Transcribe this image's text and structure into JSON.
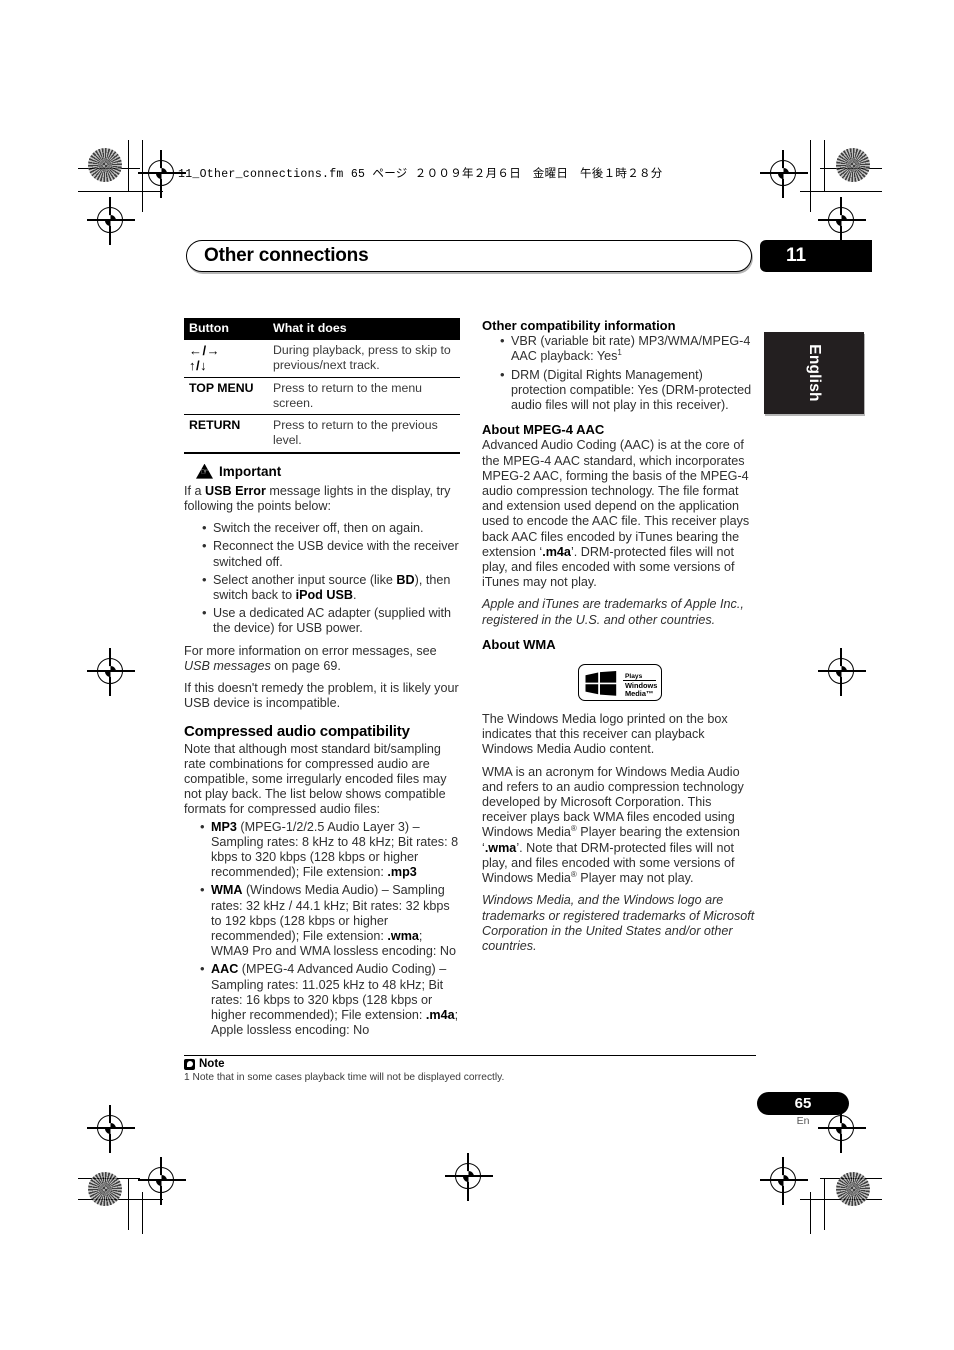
{
  "print_marks": {
    "file_stamp": "11_Other_connections.fm  65 ページ  ２００９年２月６日　金曜日　午後１時２８分"
  },
  "header": {
    "chapter_title": "Other connections",
    "chapter_number": "11",
    "language_tab": "English"
  },
  "left_column": {
    "table": {
      "headers": [
        "Button",
        "What it does"
      ],
      "rows": [
        {
          "button_lines": [
            "←/→",
            "↑/↓"
          ],
          "description": "During playback, press to skip to previous/next track."
        },
        {
          "button": "TOP MENU",
          "description": "Press to return to the menu screen."
        },
        {
          "button": "RETURN",
          "description": "Press to return to the previous level."
        }
      ]
    },
    "important": {
      "label": "Important",
      "icon": "warning-triangle-hand-icon",
      "intro_prefix": "If a ",
      "intro_bold": "USB Error",
      "intro_suffix": " message lights in the display, try following the points below:",
      "bullets": [
        "Switch the receiver off, then on again.",
        "Reconnect the USB device with the receiver switched off.",
        "Select another input source (like BD), then switch back to iPod USB.",
        "Use a dedicated AC adapter (supplied with the device) for USB power."
      ],
      "bullet3_parts": {
        "p1": "Select another input source (like ",
        "b1": "BD",
        "p2": "), then switch back to ",
        "b2": "iPod USB",
        "p3": "."
      },
      "after_1_prefix": "For more information on error messages, see ",
      "after_1_italic": "USB messages",
      "after_1_suffix": " on page 69.",
      "after_2": "If this doesn't remedy the problem, it is likely your USB device is incompatible."
    },
    "compressed": {
      "heading": "Compressed audio compatibility",
      "intro": "Note that although most standard bit/sampling rate combinations for compressed audio are compatible, some irregularly encoded files may not play back. The list below shows compatible formats for compressed audio files:",
      "formats": [
        {
          "name": "MP3",
          "detail_before_ext": " (MPEG-1/2/2.5 Audio Layer 3) – Sampling rates: 8 kHz to 48 kHz; Bit rates: 8 kbps to 320 kbps (128 kbps or higher recommended); File extension: ",
          "extension": ".mp3",
          "detail_after_ext": ""
        },
        {
          "name": "WMA",
          "detail_before_ext": " (Windows Media Audio) – Sampling rates: 32 kHz / 44.1 kHz; Bit rates: 32 kbps to 192 kbps (128 kbps or higher recommended); File extension: ",
          "extension": ".wma",
          "detail_after_ext": "; WMA9 Pro and WMA lossless encoding: No"
        },
        {
          "name": "AAC",
          "detail_before_ext": " (MPEG-4 Advanced Audio Coding) – Sampling rates: 11.025 kHz to 48 kHz; Bit rates: 16 kbps to 320 kbps (128 kbps or higher recommended); File extension: ",
          "extension": ".m4a",
          "detail_after_ext": "; Apple lossless encoding: No"
        }
      ]
    }
  },
  "right_column": {
    "other_compat": {
      "heading": "Other compatibility information",
      "bullet1_text": "VBR (variable bit rate) MP3/WMA/MPEG-4 AAC playback: Yes",
      "bullet1_sup": "1",
      "bullet2": "DRM (Digital Rights Management) protection compatible: Yes (DRM-protected audio files will not play in this receiver)."
    },
    "about_aac": {
      "heading": "About MPEG-4 AAC",
      "body_p1": "Advanced Audio Coding (AAC) is at the core of the MPEG-4 AAC standard, which incorporates MPEG-2 AAC, forming the basis of the MPEG-4 audio compression technology. The file format and extension used depend on the application used to encode the AAC file. This receiver plays back AAC files encoded by iTunes bearing the extension ‘",
      "body_ext": ".m4a",
      "body_p2": "’. DRM-protected files will not play, and files encoded with some versions of iTunes may not play.",
      "trademark": "Apple and iTunes are trademarks of Apple Inc., registered in the U.S. and other countries."
    },
    "about_wma": {
      "heading": "About WMA",
      "logo": {
        "icon": "windows-flag-icon",
        "plays": "Plays",
        "line1": "Windows",
        "line2": "Media™",
        "tm_mark": "™"
      },
      "body_p1": "The Windows Media logo printed on the box indicates that this receiver can playback Windows Media Audio content.",
      "body_p2_a": "WMA is an acronym for Windows Media Audio and refers to an audio compression technology developed by Microsoft Corporation. This receiver plays back WMA files encoded using Windows Media",
      "body_p2_sup1": "®",
      "body_p2_b": " Player bearing the extension ‘",
      "body_p2_ext": ".wma",
      "body_p2_c": "’. Note that DRM-protected files will not play, and files encoded with some versions of Windows Media",
      "body_p2_sup2": "®",
      "body_p2_d": " Player may not play.",
      "trademark": "Windows Media, and the Windows logo are trademarks or registered trademarks of Microsoft Corporation in the United States and/or other countries."
    }
  },
  "footer": {
    "note_label": "Note",
    "note_icon": "note-icon",
    "footnote": "1 Note that in some cases playback time will not be displayed correctly.",
    "page_number": "65",
    "page_language": "En"
  }
}
